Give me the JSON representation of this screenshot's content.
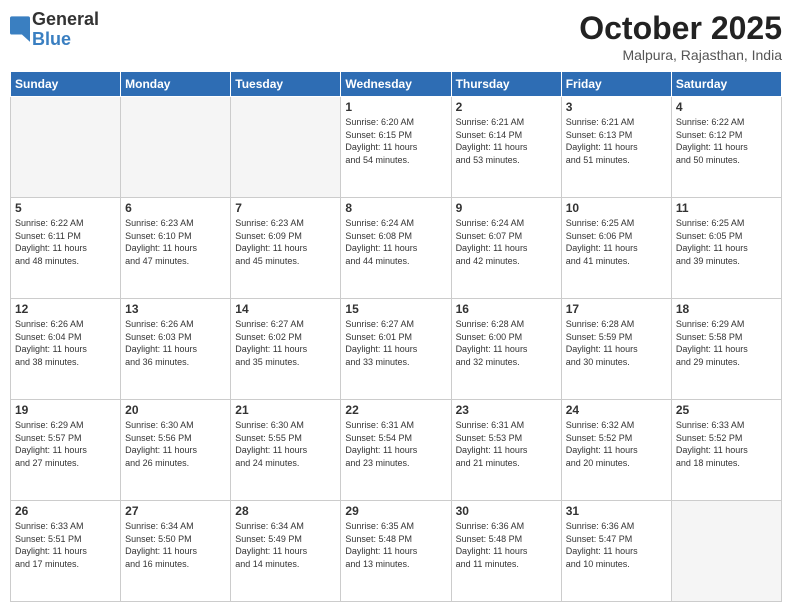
{
  "header": {
    "logo_line1": "General",
    "logo_line2": "Blue",
    "month": "October 2025",
    "location": "Malpura, Rajasthan, India"
  },
  "weekdays": [
    "Sunday",
    "Monday",
    "Tuesday",
    "Wednesday",
    "Thursday",
    "Friday",
    "Saturday"
  ],
  "weeks": [
    [
      {
        "day": "",
        "info": ""
      },
      {
        "day": "",
        "info": ""
      },
      {
        "day": "",
        "info": ""
      },
      {
        "day": "1",
        "info": "Sunrise: 6:20 AM\nSunset: 6:15 PM\nDaylight: 11 hours\nand 54 minutes."
      },
      {
        "day": "2",
        "info": "Sunrise: 6:21 AM\nSunset: 6:14 PM\nDaylight: 11 hours\nand 53 minutes."
      },
      {
        "day": "3",
        "info": "Sunrise: 6:21 AM\nSunset: 6:13 PM\nDaylight: 11 hours\nand 51 minutes."
      },
      {
        "day": "4",
        "info": "Sunrise: 6:22 AM\nSunset: 6:12 PM\nDaylight: 11 hours\nand 50 minutes."
      }
    ],
    [
      {
        "day": "5",
        "info": "Sunrise: 6:22 AM\nSunset: 6:11 PM\nDaylight: 11 hours\nand 48 minutes."
      },
      {
        "day": "6",
        "info": "Sunrise: 6:23 AM\nSunset: 6:10 PM\nDaylight: 11 hours\nand 47 minutes."
      },
      {
        "day": "7",
        "info": "Sunrise: 6:23 AM\nSunset: 6:09 PM\nDaylight: 11 hours\nand 45 minutes."
      },
      {
        "day": "8",
        "info": "Sunrise: 6:24 AM\nSunset: 6:08 PM\nDaylight: 11 hours\nand 44 minutes."
      },
      {
        "day": "9",
        "info": "Sunrise: 6:24 AM\nSunset: 6:07 PM\nDaylight: 11 hours\nand 42 minutes."
      },
      {
        "day": "10",
        "info": "Sunrise: 6:25 AM\nSunset: 6:06 PM\nDaylight: 11 hours\nand 41 minutes."
      },
      {
        "day": "11",
        "info": "Sunrise: 6:25 AM\nSunset: 6:05 PM\nDaylight: 11 hours\nand 39 minutes."
      }
    ],
    [
      {
        "day": "12",
        "info": "Sunrise: 6:26 AM\nSunset: 6:04 PM\nDaylight: 11 hours\nand 38 minutes."
      },
      {
        "day": "13",
        "info": "Sunrise: 6:26 AM\nSunset: 6:03 PM\nDaylight: 11 hours\nand 36 minutes."
      },
      {
        "day": "14",
        "info": "Sunrise: 6:27 AM\nSunset: 6:02 PM\nDaylight: 11 hours\nand 35 minutes."
      },
      {
        "day": "15",
        "info": "Sunrise: 6:27 AM\nSunset: 6:01 PM\nDaylight: 11 hours\nand 33 minutes."
      },
      {
        "day": "16",
        "info": "Sunrise: 6:28 AM\nSunset: 6:00 PM\nDaylight: 11 hours\nand 32 minutes."
      },
      {
        "day": "17",
        "info": "Sunrise: 6:28 AM\nSunset: 5:59 PM\nDaylight: 11 hours\nand 30 minutes."
      },
      {
        "day": "18",
        "info": "Sunrise: 6:29 AM\nSunset: 5:58 PM\nDaylight: 11 hours\nand 29 minutes."
      }
    ],
    [
      {
        "day": "19",
        "info": "Sunrise: 6:29 AM\nSunset: 5:57 PM\nDaylight: 11 hours\nand 27 minutes."
      },
      {
        "day": "20",
        "info": "Sunrise: 6:30 AM\nSunset: 5:56 PM\nDaylight: 11 hours\nand 26 minutes."
      },
      {
        "day": "21",
        "info": "Sunrise: 6:30 AM\nSunset: 5:55 PM\nDaylight: 11 hours\nand 24 minutes."
      },
      {
        "day": "22",
        "info": "Sunrise: 6:31 AM\nSunset: 5:54 PM\nDaylight: 11 hours\nand 23 minutes."
      },
      {
        "day": "23",
        "info": "Sunrise: 6:31 AM\nSunset: 5:53 PM\nDaylight: 11 hours\nand 21 minutes."
      },
      {
        "day": "24",
        "info": "Sunrise: 6:32 AM\nSunset: 5:52 PM\nDaylight: 11 hours\nand 20 minutes."
      },
      {
        "day": "25",
        "info": "Sunrise: 6:33 AM\nSunset: 5:52 PM\nDaylight: 11 hours\nand 18 minutes."
      }
    ],
    [
      {
        "day": "26",
        "info": "Sunrise: 6:33 AM\nSunset: 5:51 PM\nDaylight: 11 hours\nand 17 minutes."
      },
      {
        "day": "27",
        "info": "Sunrise: 6:34 AM\nSunset: 5:50 PM\nDaylight: 11 hours\nand 16 minutes."
      },
      {
        "day": "28",
        "info": "Sunrise: 6:34 AM\nSunset: 5:49 PM\nDaylight: 11 hours\nand 14 minutes."
      },
      {
        "day": "29",
        "info": "Sunrise: 6:35 AM\nSunset: 5:48 PM\nDaylight: 11 hours\nand 13 minutes."
      },
      {
        "day": "30",
        "info": "Sunrise: 6:36 AM\nSunset: 5:48 PM\nDaylight: 11 hours\nand 11 minutes."
      },
      {
        "day": "31",
        "info": "Sunrise: 6:36 AM\nSunset: 5:47 PM\nDaylight: 11 hours\nand 10 minutes."
      },
      {
        "day": "",
        "info": ""
      }
    ]
  ]
}
